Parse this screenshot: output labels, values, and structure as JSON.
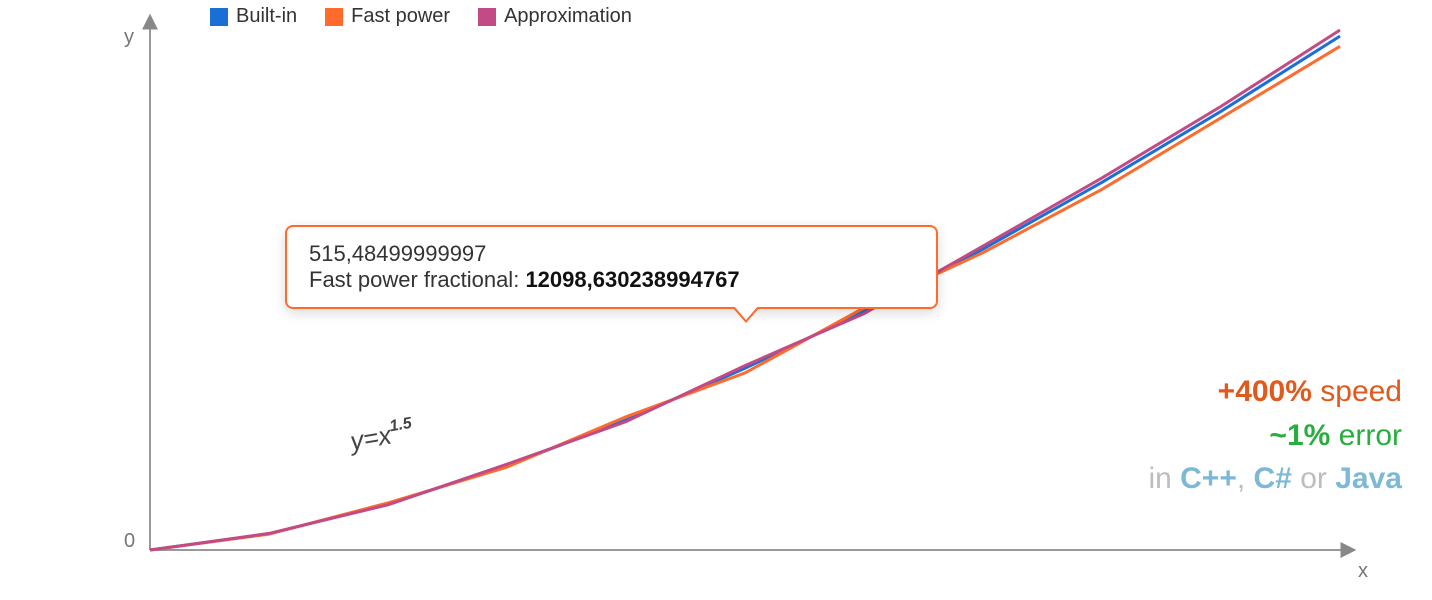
{
  "chart_data": {
    "type": "line",
    "title": "",
    "xlabel": "x",
    "ylabel": "y",
    "xlim": [
      0,
      1000
    ],
    "ylim": [
      0,
      32000
    ],
    "formula": "y=x",
    "formula_exp": "1.5",
    "series": [
      {
        "name": "Built-in",
        "color": "#1a6fd6",
        "x": [
          0,
          100,
          200,
          300,
          400,
          500,
          600,
          700,
          800,
          900,
          1000
        ],
        "values": [
          0,
          1000,
          2828,
          5196,
          8000,
          11180,
          14697,
          18520,
          22628,
          27000,
          31623
        ]
      },
      {
        "name": "Fast power",
        "color": "#ff6b2c",
        "x": [
          0,
          100,
          200,
          300,
          400,
          500,
          600,
          700,
          800,
          900,
          1000
        ],
        "values": [
          0,
          980,
          2900,
          5100,
          8200,
          10900,
          14900,
          18300,
          22200,
          26600,
          31000
        ]
      },
      {
        "name": "Approximation",
        "color": "#c24a85",
        "x": [
          0,
          100,
          200,
          300,
          400,
          500,
          600,
          700,
          800,
          900,
          1000
        ],
        "values": [
          0,
          1020,
          2780,
          5280,
          7900,
          11350,
          14550,
          18700,
          22900,
          27300,
          32000
        ]
      }
    ],
    "legend_position": "top",
    "grid": false,
    "tooltip": {
      "x_value": "515,48499999997",
      "series_name": "Fast power fractional",
      "series_value": "12098,630238994767"
    }
  },
  "legend": {
    "items": [
      {
        "label": "Built-in",
        "color": "#1a6fd6"
      },
      {
        "label": "Fast power",
        "color": "#ff6b2c"
      },
      {
        "label": "Approximation",
        "color": "#c24a85"
      }
    ]
  },
  "axes": {
    "y_label": "y",
    "x_label": "x",
    "origin_label": "0"
  },
  "formula": {
    "base": "y=x",
    "exp": "1.5"
  },
  "tooltip": {
    "line1": "515,48499999997",
    "line2_label": "Fast power fractional: ",
    "line2_value": "12098,630238994767"
  },
  "callouts": {
    "speed_value": "+400%",
    "speed_word": " speed",
    "error_value": "~1%",
    "error_word": " error",
    "lang_prefix": "in ",
    "lang1": "C++",
    "sep1": ", ",
    "lang2": "C#",
    "sep2": " or ",
    "lang3": "Java"
  }
}
